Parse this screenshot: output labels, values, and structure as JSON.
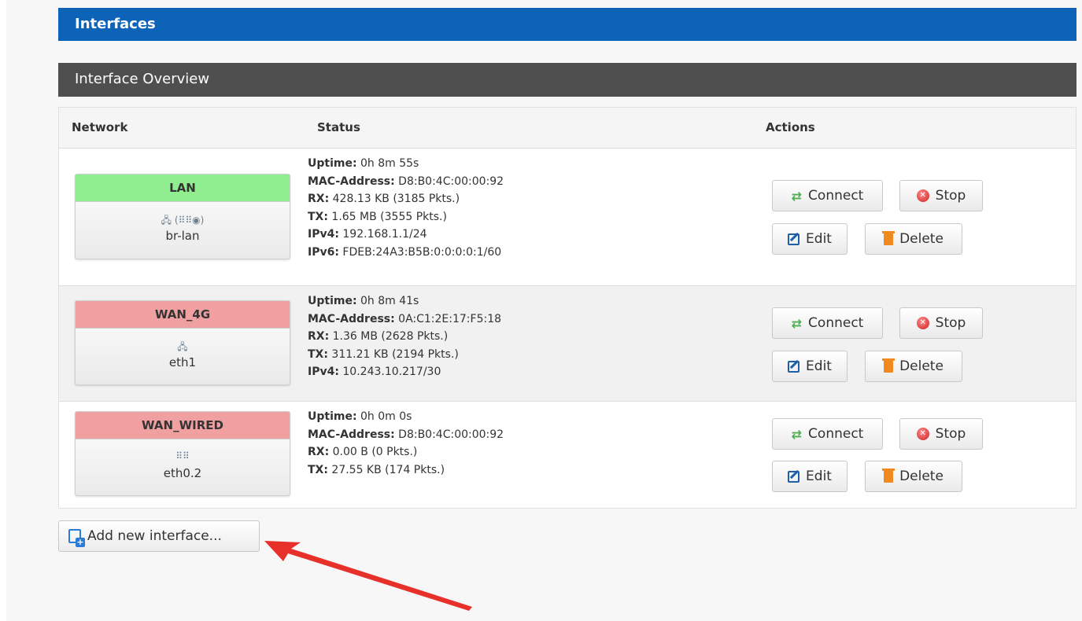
{
  "page": {
    "title": "Interfaces"
  },
  "section": {
    "title": "Interface Overview"
  },
  "table": {
    "headers": {
      "network": "Network",
      "status": "Status",
      "actions": "Actions"
    }
  },
  "labels": {
    "uptime": "Uptime:",
    "mac": "MAC-Address:",
    "rx": "RX:",
    "tx": "TX:",
    "ipv4": "IPv4:",
    "ipv6": "IPv6:"
  },
  "buttons": {
    "connect": "Connect",
    "stop": "Stop",
    "edit": "Edit",
    "delete": "Delete",
    "add_interface": "Add new interface..."
  },
  "interfaces": [
    {
      "name": "LAN",
      "state": "up",
      "device": "br-lan",
      "icons": [
        "ethernet-port-icon",
        "bridge-icon",
        "wireless-icon"
      ],
      "uptime": "0h 8m 55s",
      "mac": "D8:B0:4C:00:00:92",
      "rx": "428.13 KB (3185 Pkts.)",
      "tx": "1.65 MB (3555 Pkts.)",
      "ipv4": "192.168.1.1/24",
      "ipv6": "FDEB:24A3:B5B:0:0:0:0:1/60"
    },
    {
      "name": "WAN_4G",
      "state": "down",
      "device": "eth1",
      "icons": [
        "ethernet-port-icon"
      ],
      "uptime": "0h 8m 41s",
      "mac": "0A:C1:2E:17:F5:18",
      "rx": "1.36 MB (2628 Pkts.)",
      "tx": "311.21 KB (2194 Pkts.)",
      "ipv4": "10.243.10.217/30"
    },
    {
      "name": "WAN_WIRED",
      "state": "down",
      "device": "eth0.2",
      "icons": [
        "switch-port-icon"
      ],
      "uptime": "0h 0m 0s",
      "mac": "D8:B0:4C:00:00:92",
      "rx": "0.00 B (0 Pkts.)",
      "tx": "27.55 KB (174 Pkts.)"
    }
  ],
  "colors": {
    "header_blue": "#0d63b8",
    "section_gray": "#4f4f4f",
    "status_up": "#90ee90",
    "status_down": "#f0a0a0",
    "annotation_arrow": "#e8302a"
  }
}
